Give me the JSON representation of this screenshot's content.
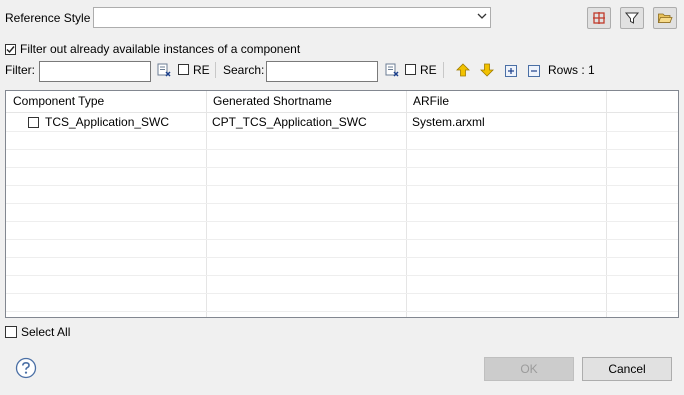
{
  "header": {
    "reference_style_label": "Reference Style",
    "reference_style_value": ""
  },
  "filter_option": {
    "label": "Filter out already available instances of a component",
    "checked": true
  },
  "toolbar": {
    "filter_label": "Filter:",
    "filter_value": "",
    "filter_re_label": "RE",
    "search_label": "Search:",
    "search_value": "",
    "search_re_label": "RE",
    "rows_label": "Rows : 1"
  },
  "table": {
    "columns": [
      "Component Type",
      "Generated Shortname",
      "ARFile"
    ],
    "rows": [
      {
        "component_type": "TCS_Application_SWC",
        "shortname": "CPT_TCS_Application_SWC",
        "arfile": "System.arxml",
        "checked": false
      }
    ]
  },
  "select_all_label": "Select All",
  "buttons": {
    "ok_label": "OK",
    "cancel_label": "Cancel"
  },
  "colors": {
    "accent_red": "#c0392b",
    "arrow_yellow": "#f2c200",
    "help_blue": "#4a6fa5"
  },
  "icons": [
    "grid-icon",
    "filter-icon",
    "folder-open-icon",
    "clear-filter-icon",
    "arrow-up-icon",
    "arrow-down-icon",
    "expand-all-icon",
    "collapse-all-icon",
    "help-icon",
    "chevron-down-icon"
  ]
}
